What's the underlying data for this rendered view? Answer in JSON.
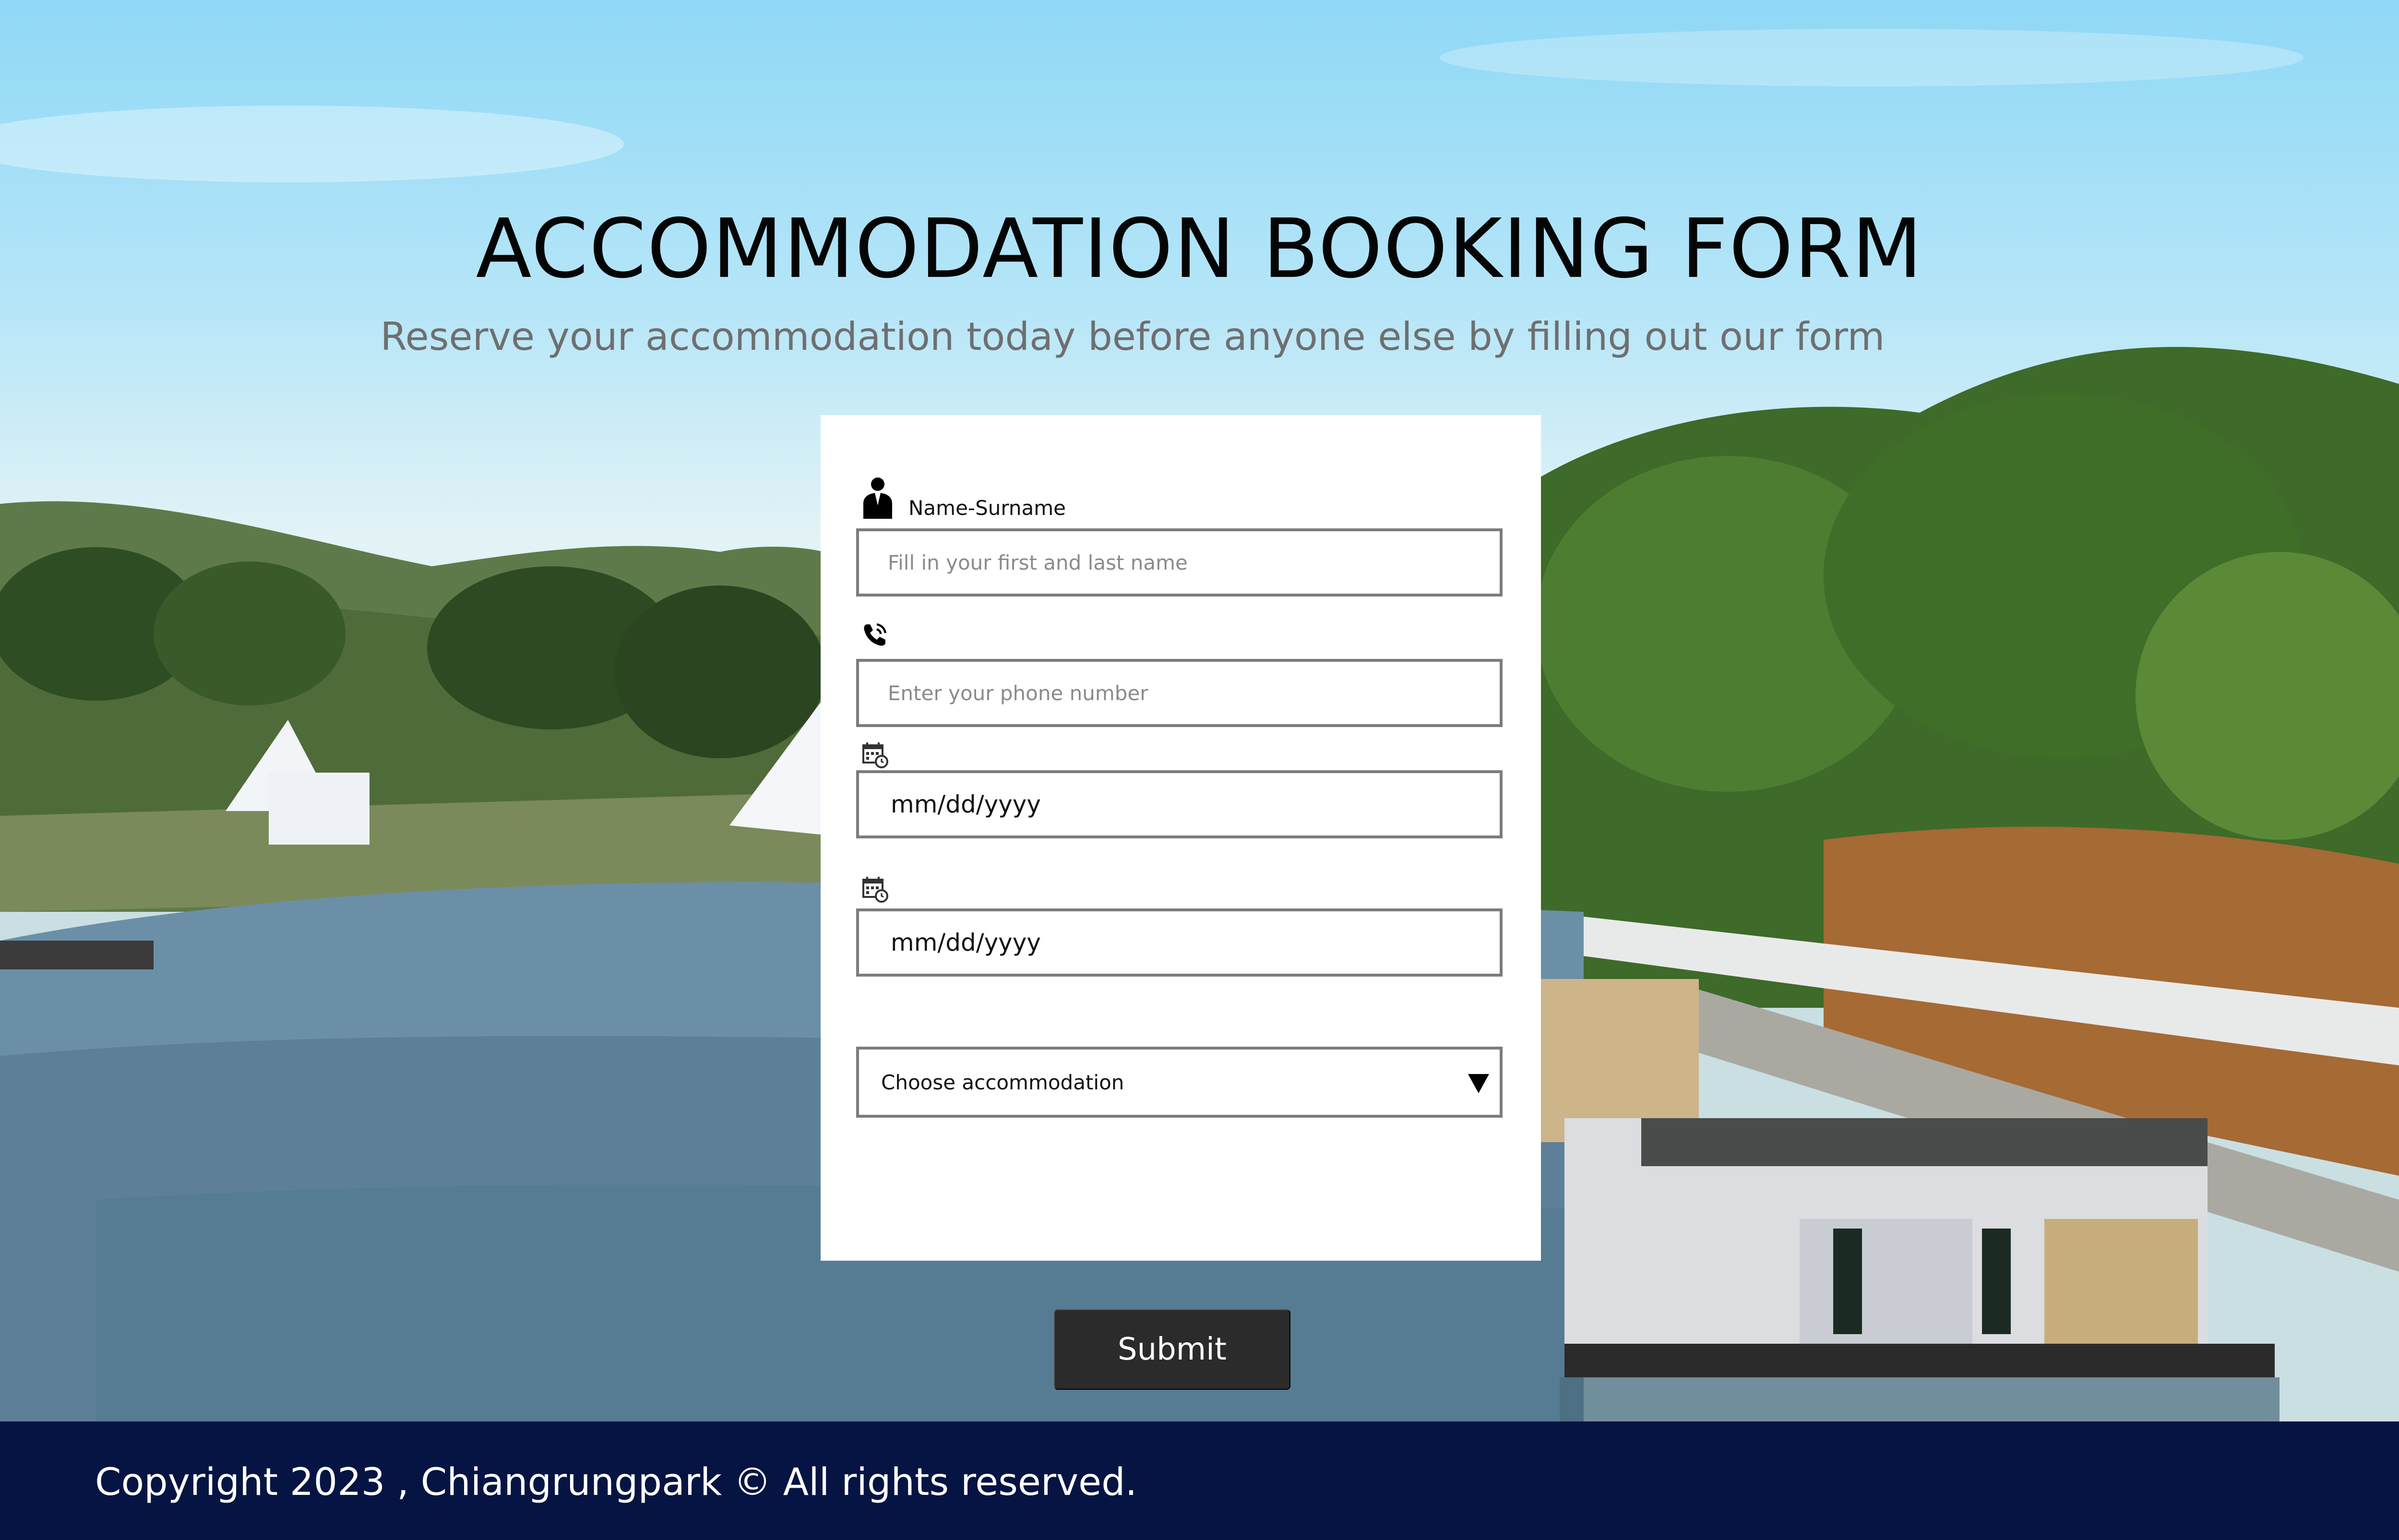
{
  "header": {
    "title": "ACCOMMODATION BOOKING FORM",
    "subtitle": "Reserve your accommodation today before anyone else by filling out our form"
  },
  "form": {
    "name": {
      "label": "Name-Surname",
      "icon": "person-icon",
      "placeholder": "Fill in your first and last name"
    },
    "phone": {
      "icon": "phone-icon",
      "placeholder": "Enter your phone number"
    },
    "checkin": {
      "icon": "calendar-icon",
      "value": "mm/dd/yyyy"
    },
    "checkout": {
      "icon": "calendar-icon",
      "value": "mm/dd/yyyy"
    },
    "accommodation": {
      "selected": "Choose accommodation",
      "icon": "chevron-down-icon"
    },
    "submit_label": "Submit"
  },
  "footer": {
    "copyright": "Copyright 2023 , Chiangrungpark © All rights reserved."
  },
  "colors": {
    "footer_bg": "#061443",
    "submit_bg": "#2b2b2b",
    "card_bg": "#ffffff",
    "input_border": "#7c7c7c"
  }
}
